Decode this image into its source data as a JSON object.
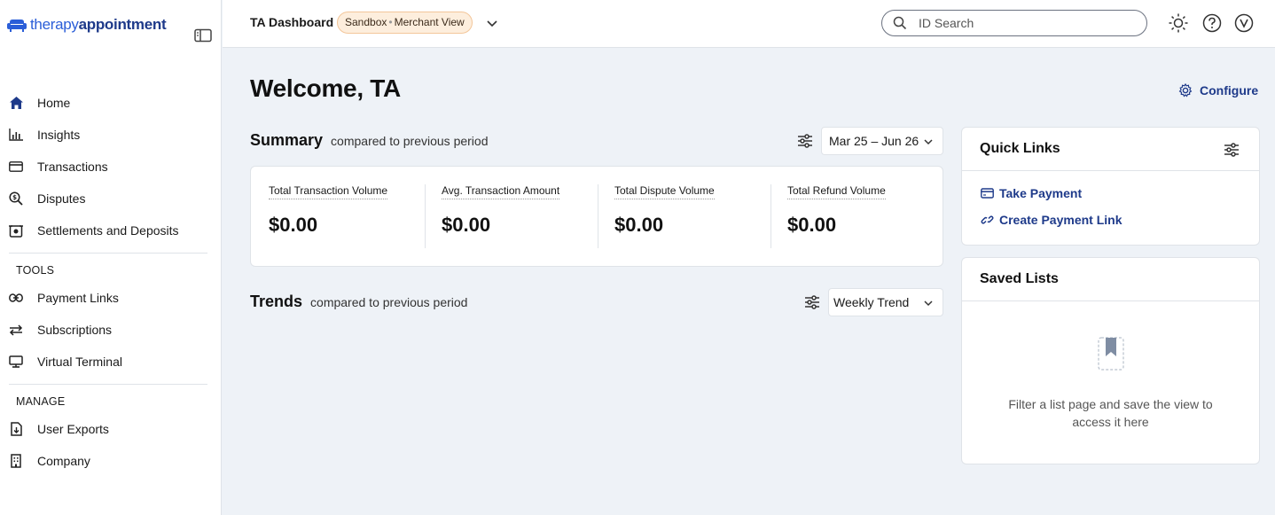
{
  "brand": {
    "part1": "therapy",
    "part2": "appointment",
    "accent": "#2b5ed8",
    "dark_accent": "#1e3a8a"
  },
  "sidebar": {
    "primary": [
      {
        "label": "Home",
        "icon": "home-icon"
      },
      {
        "label": "Insights",
        "icon": "chart-icon"
      },
      {
        "label": "Transactions",
        "icon": "card-icon"
      },
      {
        "label": "Disputes",
        "icon": "search-dispute-icon"
      },
      {
        "label": "Settlements and Deposits",
        "icon": "deposit-icon"
      }
    ],
    "tools_label": "TOOLS",
    "tools": [
      {
        "label": "Payment Links",
        "icon": "link-icon"
      },
      {
        "label": "Subscriptions",
        "icon": "repeat-icon"
      },
      {
        "label": "Virtual Terminal",
        "icon": "terminal-icon"
      }
    ],
    "manage_label": "MANAGE",
    "manage": [
      {
        "label": "User Exports",
        "icon": "export-icon"
      },
      {
        "label": "Company",
        "icon": "building-icon"
      }
    ]
  },
  "topbar": {
    "title": "TA Dashboard",
    "badge_left": "Sandbox",
    "badge_sep": "•",
    "badge_right": "Merchant View",
    "search_placeholder": "ID Search"
  },
  "main": {
    "welcome": "Welcome, TA",
    "configure": "Configure",
    "summary": {
      "title": "Summary",
      "subtitle": "compared to previous period",
      "date_range": "Mar 25 – Jun 26",
      "metrics": [
        {
          "label": "Total Transaction Volume",
          "value": "$0.00"
        },
        {
          "label": "Avg. Transaction Amount",
          "value": "$0.00"
        },
        {
          "label": "Total Dispute Volume",
          "value": "$0.00"
        },
        {
          "label": "Total Refund Volume",
          "value": "$0.00"
        }
      ]
    },
    "trends": {
      "title": "Trends",
      "subtitle": "compared to previous period",
      "selected": "Weekly Trend"
    }
  },
  "quick_links": {
    "title": "Quick Links",
    "links": [
      {
        "label": "Take Payment"
      },
      {
        "label": "Create Payment Link"
      }
    ]
  },
  "saved_lists": {
    "title": "Saved Lists",
    "empty_text": "Filter a list page and save the view to access it here"
  }
}
